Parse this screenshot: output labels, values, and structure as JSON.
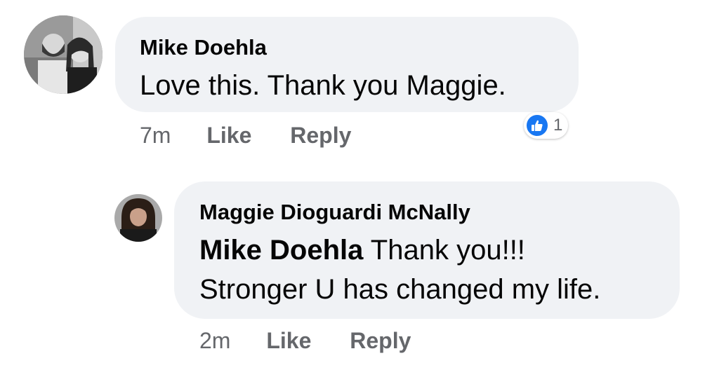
{
  "comments": [
    {
      "author": "Mike Doehla",
      "text": "Love this. Thank you Maggie.",
      "time": "7m",
      "like_label": "Like",
      "reply_label": "Reply",
      "reaction": {
        "icon": "thumbs-up-icon",
        "count": "1",
        "color": "#1877f2"
      }
    },
    {
      "author": "Maggie Dioguardi McNally",
      "mention": "Mike Doehla",
      "text_line1": "Thank you!!!",
      "text_line2": "Stronger U has changed my life.",
      "time": "2m",
      "like_label": "Like",
      "reply_label": "Reply"
    }
  ],
  "colors": {
    "bubble": "#f0f2f5",
    "meta_text": "#65676b",
    "primary_text": "#050505",
    "accent": "#1877f2"
  }
}
